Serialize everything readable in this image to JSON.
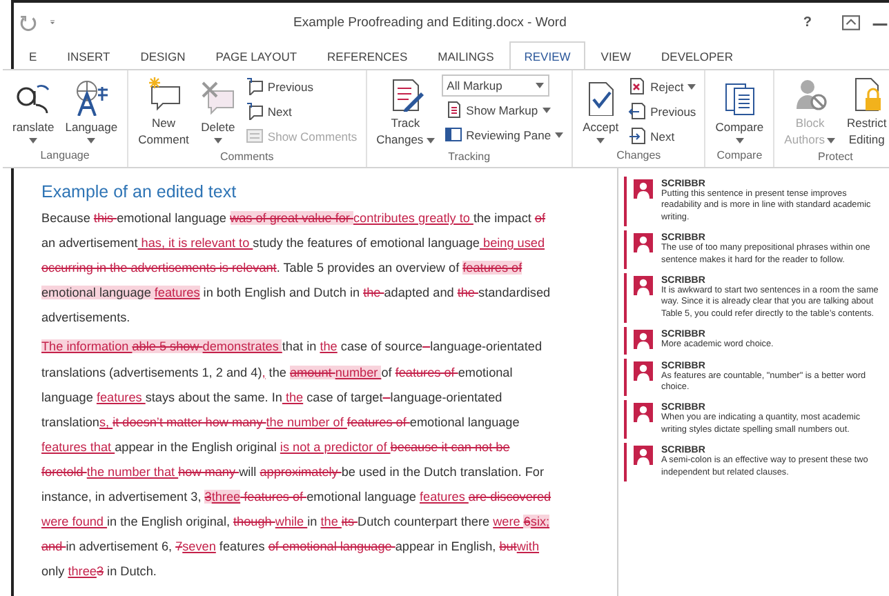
{
  "window": {
    "title": "Example Proofreading and Editing.docx - Word",
    "help": "?"
  },
  "tabs": [
    {
      "label": "E",
      "selected": false
    },
    {
      "label": "INSERT",
      "selected": false
    },
    {
      "label": "DESIGN",
      "selected": false
    },
    {
      "label": "PAGE LAYOUT",
      "selected": false
    },
    {
      "label": "REFERENCES",
      "selected": false
    },
    {
      "label": "MAILINGS",
      "selected": false
    },
    {
      "label": "REVIEW",
      "selected": true
    },
    {
      "label": "VIEW",
      "selected": false
    },
    {
      "label": "DEVELOPER",
      "selected": false
    }
  ],
  "ribbon": [
    {
      "label": "Language",
      "items": [
        {
          "kind": "large",
          "lines": [
            "ranslate"
          ],
          "has_menu": true,
          "disabled": false
        },
        {
          "kind": "large",
          "lines": [
            "Language"
          ],
          "has_menu": true,
          "disabled": false
        }
      ]
    },
    {
      "label": "Comments",
      "items": [
        {
          "kind": "large",
          "lines": [
            "New",
            "Comment"
          ],
          "has_menu": false,
          "disabled": false
        },
        {
          "kind": "large",
          "lines": [
            "Delete"
          ],
          "has_menu": true,
          "disabled": false
        },
        {
          "kind": "stack",
          "items": [
            {
              "kind": "small",
              "label": "Previous",
              "has_menu": false,
              "disabled": false
            },
            {
              "kind": "small",
              "label": "Next",
              "has_menu": false,
              "disabled": false
            },
            {
              "kind": "small",
              "label": "Show Comments",
              "has_menu": false,
              "disabled": true
            }
          ]
        }
      ]
    },
    {
      "label": "Tracking",
      "items": [
        {
          "kind": "large",
          "lines": [
            "Track",
            "Changes"
          ],
          "has_menu": true,
          "disabled": false
        },
        {
          "kind": "stack",
          "items": [
            {
              "kind": "dropdown",
              "label": "All Markup",
              "has_menu": true,
              "disabled": false
            },
            {
              "kind": "small",
              "label": "Show Markup",
              "has_menu": true,
              "disabled": false
            },
            {
              "kind": "small",
              "label": "Reviewing Pane",
              "has_menu": true,
              "disabled": false
            }
          ]
        }
      ]
    },
    {
      "label": "Changes",
      "items": [
        {
          "kind": "large",
          "lines": [
            "Accept"
          ],
          "has_menu": true,
          "disabled": false
        },
        {
          "kind": "stack",
          "items": [
            {
              "kind": "small",
              "label": "Reject",
              "has_menu": true,
              "disabled": false
            },
            {
              "kind": "small",
              "label": "Previous",
              "has_menu": false,
              "disabled": false
            },
            {
              "kind": "small",
              "label": "Next",
              "has_menu": false,
              "disabled": false
            }
          ]
        }
      ]
    },
    {
      "label": "Compare",
      "items": [
        {
          "kind": "large",
          "lines": [
            "Compare"
          ],
          "has_menu": true,
          "disabled": false
        }
      ]
    },
    {
      "label": "Protect",
      "items": [
        {
          "kind": "large",
          "lines": [
            "Block",
            "Authors"
          ],
          "has_menu": true,
          "disabled": true
        },
        {
          "kind": "large",
          "lines": [
            "Restrict",
            "Editing"
          ],
          "has_menu": false,
          "disabled": false
        }
      ]
    }
  ],
  "document": {
    "heading": "Example of an edited text",
    "paragraphs": [
      {
        "lines": [
          [
            {
              "kind": "plain",
              "text": "Because "
            },
            {
              "kind": "del",
              "text": "this "
            },
            {
              "kind": "plain",
              "text": "emotional language "
            },
            {
              "kind": "del",
              "text": "was of great value for ",
              "highlight": true
            },
            {
              "kind": "ins",
              "text": "contributes greatly to "
            },
            {
              "kind": "plain",
              "text": "the impact "
            },
            {
              "kind": "del",
              "text": "of"
            }
          ],
          [
            {
              "kind": "plain",
              "text": "an advertisement"
            },
            {
              "kind": "ins",
              "text": " has,"
            },
            {
              "kind": "ins",
              "text": " it is relevant to "
            },
            {
              "kind": "plain",
              "text": "study the features of emotional language"
            },
            {
              "kind": "ins",
              "text": " being used"
            }
          ],
          [
            {
              "kind": "del",
              "text": "occurring in the advertisements is relevant"
            },
            {
              "kind": "plain",
              "text": ". Table 5 provides an overview of "
            },
            {
              "kind": "del",
              "text": "features of",
              "highlight": true
            }
          ],
          [
            {
              "kind": "plain",
              "text": "emotional language ",
              "highlight": true
            },
            {
              "kind": "ins",
              "text": "features",
              "highlight": true
            },
            {
              "kind": "plain",
              "text": " in both English and Dutch in "
            },
            {
              "kind": "del",
              "text": "the "
            },
            {
              "kind": "plain",
              "text": "adapted and "
            },
            {
              "kind": "del",
              "text": "the "
            },
            {
              "kind": "plain",
              "text": "standardised"
            }
          ],
          [
            {
              "kind": "plain",
              "text": "advertisements."
            }
          ]
        ]
      },
      {
        "lines": [
          [
            {
              "kind": "ins",
              "text": "The information ",
              "highlight": true
            },
            {
              "kind": "del",
              "text": "able 5 show ",
              "highlight": true
            },
            {
              "kind": "ins",
              "text": "demonstrates ",
              "highlight": true
            },
            {
              "kind": "plain",
              "text": "that in "
            },
            {
              "kind": "ins",
              "text": "the"
            },
            {
              "kind": "plain",
              "text": " case of source"
            },
            {
              "kind": "del",
              "text": " -"
            },
            {
              "kind": "plain",
              "text": "language-orientated"
            }
          ],
          [
            {
              "kind": "plain",
              "text": "translations (advertisements 1, 2 and 4)"
            },
            {
              "kind": "ins",
              "text": ","
            },
            {
              "kind": "plain",
              "text": " the "
            },
            {
              "kind": "del",
              "text": "amount ",
              "highlight": true
            },
            {
              "kind": "ins",
              "text": "number ",
              "highlight": true
            },
            {
              "kind": "plain",
              "text": "of "
            },
            {
              "kind": "del",
              "text": "features of "
            },
            {
              "kind": "plain",
              "text": "emotional"
            }
          ],
          [
            {
              "kind": "plain",
              "text": "language "
            },
            {
              "kind": "ins",
              "text": "features "
            },
            {
              "kind": "plain",
              "text": "stays about the same. In"
            },
            {
              "kind": "ins",
              "text": " the"
            },
            {
              "kind": "plain",
              "text": " case of target"
            },
            {
              "kind": "del",
              "text": " -"
            },
            {
              "kind": "plain",
              "text": "language-orientated"
            }
          ],
          [
            {
              "kind": "plain",
              "text": "translation"
            },
            {
              "kind": "ins",
              "text": "s, "
            },
            {
              "kind": "del",
              "text": "it doesn’t matter how many "
            },
            {
              "kind": "ins",
              "text": "the number of "
            },
            {
              "kind": "del",
              "text": "features of "
            },
            {
              "kind": "plain",
              "text": "emotional language"
            }
          ],
          [
            {
              "kind": "ins",
              "text": "features that "
            },
            {
              "kind": "plain",
              "text": "appear in the English original "
            },
            {
              "kind": "ins",
              "text": "is not a predictor of "
            },
            {
              "kind": "del",
              "text": "because it can not be"
            }
          ],
          [
            {
              "kind": "del",
              "text": "foretold "
            },
            {
              "kind": "ins",
              "text": "the number that "
            },
            {
              "kind": "del",
              "text": "how many "
            },
            {
              "kind": "plain",
              "text": "will "
            },
            {
              "kind": "del",
              "text": "approximately "
            },
            {
              "kind": "plain",
              "text": "be used in the Dutch translation. For"
            }
          ],
          [
            {
              "kind": "plain",
              "text": "instance, in advertisement 3, "
            },
            {
              "kind": "del",
              "text": "3",
              "highlight": true
            },
            {
              "kind": "ins",
              "text": "three",
              "highlight": true
            },
            {
              "kind": "del",
              "text": " features of "
            },
            {
              "kind": "plain",
              "text": "emotional language "
            },
            {
              "kind": "ins",
              "text": "features "
            },
            {
              "kind": "del",
              "text": "are discovered"
            }
          ],
          [
            {
              "kind": "ins",
              "text": "were found "
            },
            {
              "kind": "plain",
              "text": "in the English original, "
            },
            {
              "kind": "del",
              "text": "though "
            },
            {
              "kind": "ins",
              "text": "while "
            },
            {
              "kind": "plain",
              "text": "in "
            },
            {
              "kind": "ins",
              "text": "the "
            },
            {
              "kind": "del",
              "text": "its "
            },
            {
              "kind": "plain",
              "text": "Dutch counterpart there "
            },
            {
              "kind": "ins",
              "text": "were "
            },
            {
              "kind": "del",
              "text": "6",
              "highlight": true
            },
            {
              "kind": "ins",
              "text": "six;",
              "highlight": true
            }
          ],
          [
            {
              "kind": "del",
              "text": "and "
            },
            {
              "kind": "plain",
              "text": "in advertisement 6, "
            },
            {
              "kind": "del",
              "text": "7"
            },
            {
              "kind": "ins",
              "text": "seven"
            },
            {
              "kind": "plain",
              "text": " features "
            },
            {
              "kind": "del",
              "text": "of emotional language "
            },
            {
              "kind": "plain",
              "text": "appear in English, "
            },
            {
              "kind": "del",
              "text": "but"
            },
            {
              "kind": "ins",
              "text": "with"
            }
          ],
          [
            {
              "kind": "plain",
              "text": "only "
            },
            {
              "kind": "ins",
              "text": "three"
            },
            {
              "kind": "del",
              "text": "3"
            },
            {
              "kind": "plain",
              "text": " in Dutch."
            }
          ]
        ]
      }
    ]
  },
  "comments": [
    {
      "author": "SCRIBBR",
      "text": "Putting this sentence in present tense improves readability and is more in line with standard academic writing."
    },
    {
      "author": "SCRIBBR",
      "text": "The use of too many prepositional phrases within one sentence makes it hard for the reader to follow."
    },
    {
      "author": "SCRIBBR",
      "text": "It is awkward to start two sentences in a room the same way. Since it is already clear that you are talking about Table 5, you could refer directly to the table’s contents."
    },
    {
      "author": "SCRIBBR",
      "text": "More academic word choice."
    },
    {
      "author": "SCRIBBR",
      "text": "As features are countable, \"number\" is a better word choice."
    },
    {
      "author": "SCRIBBR",
      "text": "When you are indicating a quantity, most academic writing styles dictate spelling small numbers out."
    },
    {
      "author": "SCRIBBR",
      "text": "A semi-colon is an effective way to present these two independent but related clauses."
    }
  ]
}
